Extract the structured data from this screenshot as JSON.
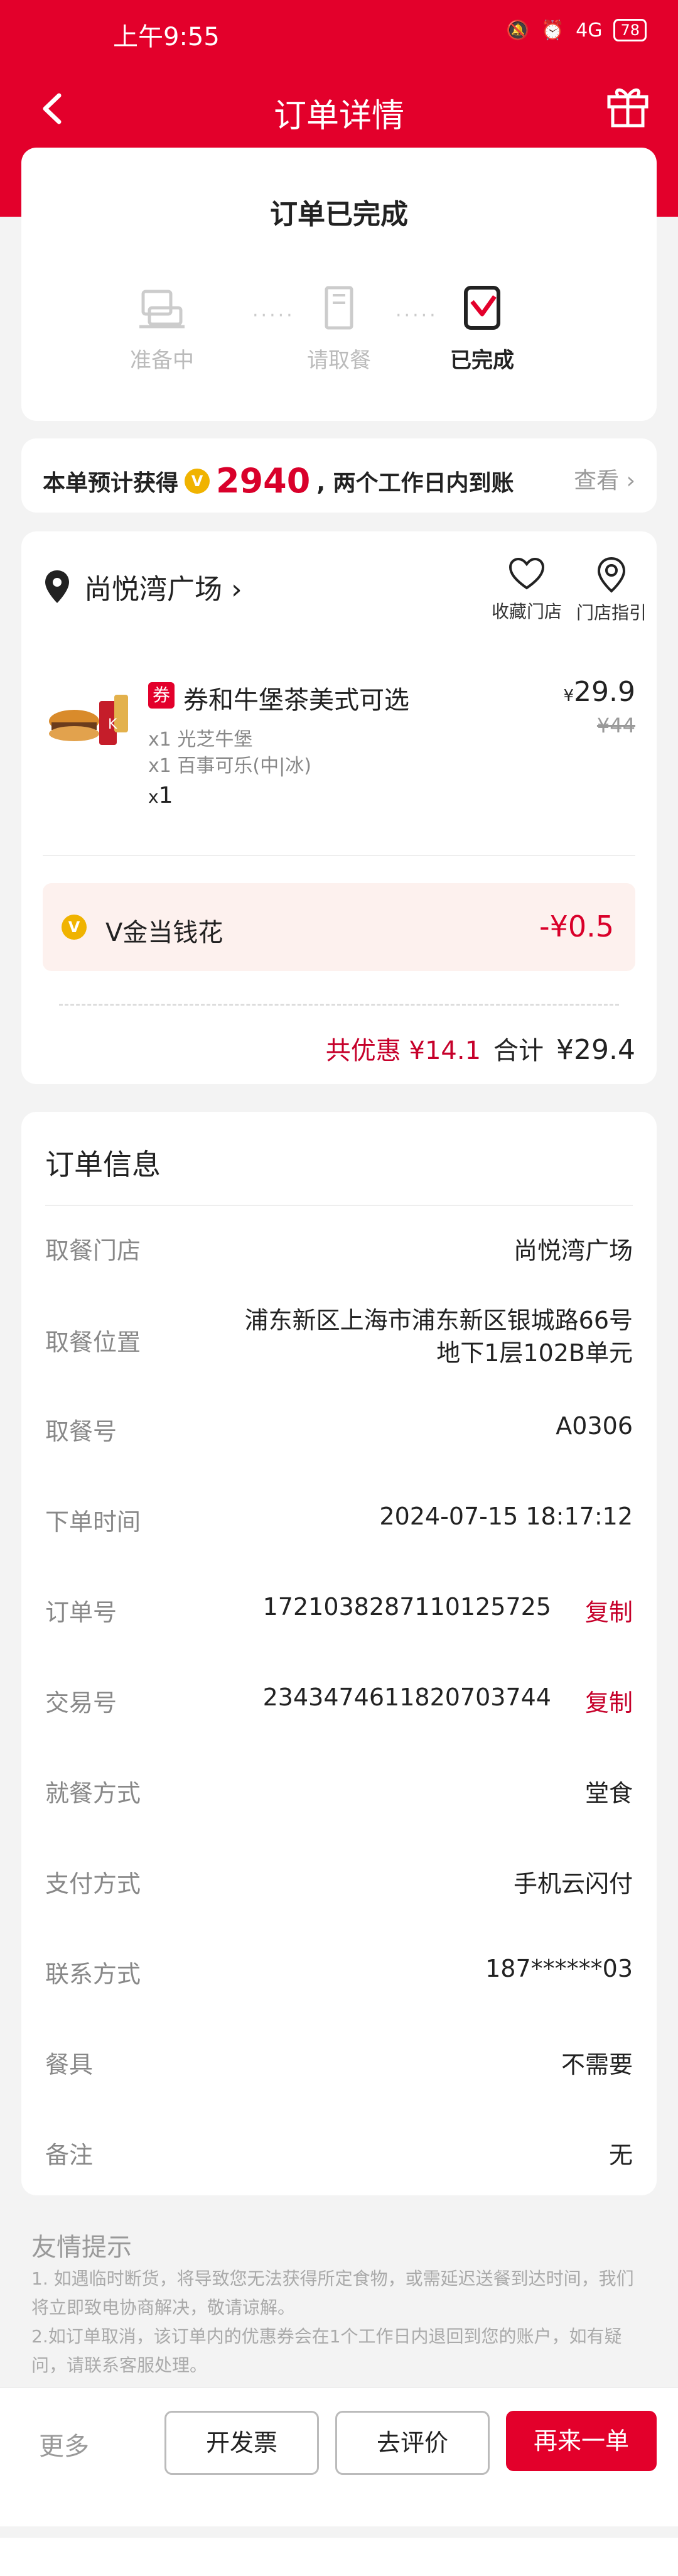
{
  "status_bar": {
    "time": "上午9:55",
    "battery": "78",
    "network": "4G"
  },
  "nav": {
    "title": "订单详情"
  },
  "order_status": {
    "title": "订单已完成",
    "steps": [
      {
        "label": "准备中",
        "icon": "cup-icon",
        "active": false
      },
      {
        "label": "请取餐",
        "icon": "bag-icon",
        "active": false
      },
      {
        "label": "已完成",
        "icon": "check-box-icon",
        "active": true
      }
    ]
  },
  "points": {
    "prefix": "本单预计获得",
    "amount": "2940",
    "suffix": ", 两个工作日内到账",
    "view_label": "查看",
    "coin_glyph": "V"
  },
  "store": {
    "name": "尚悦湾广场",
    "arrow": "›",
    "favorite_label": "收藏门店",
    "guide_label": "门店指引"
  },
  "product": {
    "badge": "券",
    "name": "券和牛堡茶美式可选",
    "items": [
      "x1 光芝牛堡",
      "x1 百事可乐(中|冰)"
    ],
    "qty_prefix": "x",
    "qty": "1",
    "currency": "¥",
    "price": "29.9",
    "original_price": "¥44"
  },
  "vgold": {
    "label": "V金当钱花",
    "amount": "-¥0.5"
  },
  "total": {
    "discount_label": "共优惠",
    "discount": "¥14.1",
    "total_label": "合计",
    "total": "¥29.4"
  },
  "info": {
    "title": "订单信息",
    "rows": [
      {
        "key": "取餐门店",
        "value": "尚悦湾广场"
      },
      {
        "key": "取餐位置",
        "value": "浦东新区上海市浦东新区银城路66号地下1层102B单元"
      },
      {
        "key": "取餐号",
        "value": "A0306"
      },
      {
        "key": "下单时间",
        "value": "2024-07-15 18:17:12"
      },
      {
        "key": "订单号",
        "value": "1721038287110125725",
        "action": "复制"
      },
      {
        "key": "交易号",
        "value": "2343474611820703744",
        "action": "复制"
      },
      {
        "key": "就餐方式",
        "value": "堂食"
      },
      {
        "key": "支付方式",
        "value": "手机云闪付"
      },
      {
        "key": "联系方式",
        "value": "187******03"
      },
      {
        "key": "餐具",
        "value": "不需要"
      },
      {
        "key": "备注",
        "value": "无"
      }
    ]
  },
  "tips": {
    "title": "友情提示",
    "lines": [
      "1. 如遇临时断货，将导致您无法获得所定食物，或需延迟送餐到达时间，我们将立即致电协商解决，敬请谅解。",
      "2.如订单取消，该订单内的优惠券会在1个工作日内退回到您的账户，如有疑问，请联系客服处理。"
    ]
  },
  "bottom": {
    "more": "更多",
    "invoice": "开发票",
    "review": "去评价",
    "reorder": "再来一单"
  },
  "colors": {
    "brand": "#e3002b",
    "accent": "#c6002a",
    "coin": "#f0b300"
  }
}
